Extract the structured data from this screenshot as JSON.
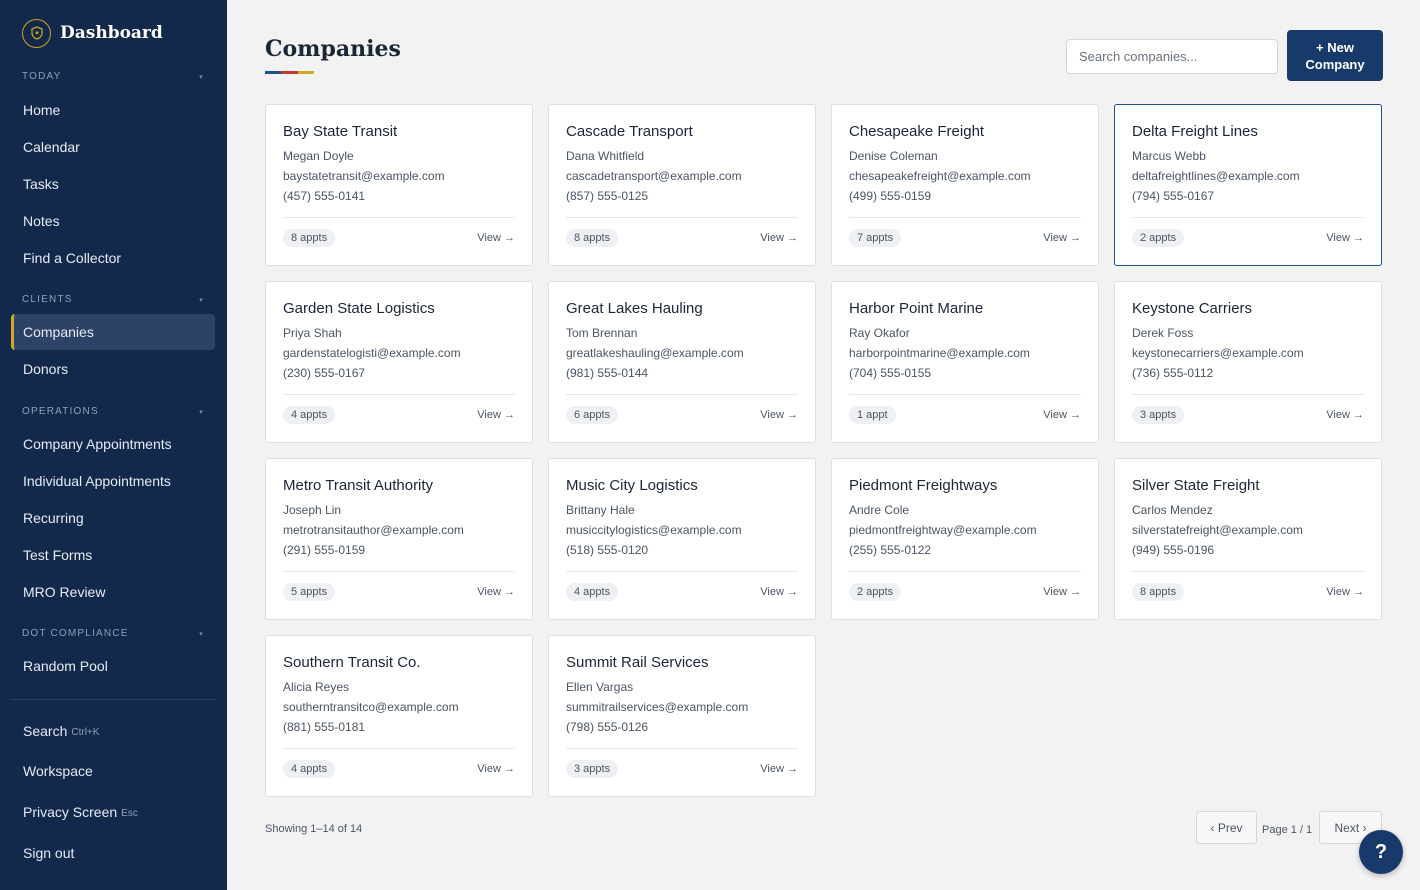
{
  "sidebar": {
    "brand": "Dashboard",
    "sections": [
      {
        "title": "TODAY",
        "items": [
          {
            "label": "Home"
          },
          {
            "label": "Calendar"
          },
          {
            "label": "Tasks"
          },
          {
            "label": "Notes"
          },
          {
            "label": "Find a Collector"
          }
        ]
      },
      {
        "title": "CLIENTS",
        "items": [
          {
            "label": "Companies",
            "active": true
          },
          {
            "label": "Donors"
          }
        ]
      },
      {
        "title": "OPERATIONS",
        "items": [
          {
            "label": "Company Appointments"
          },
          {
            "label": "Individual Appointments"
          },
          {
            "label": "Recurring"
          },
          {
            "label": "Test Forms"
          },
          {
            "label": "MRO Review"
          }
        ]
      },
      {
        "title": "DOT COMPLIANCE",
        "items": [
          {
            "label": "Random Pool"
          }
        ]
      }
    ],
    "bottom": {
      "search": {
        "label": "Search",
        "shortcut": "Ctrl+K"
      },
      "workspace": "Workspace",
      "privacy": {
        "label": "Privacy Screen",
        "shortcut": "Esc"
      },
      "signout": "Sign out"
    }
  },
  "header": {
    "title": "Companies",
    "search_placeholder": "Search companies...",
    "new_button": "+ New\nCompany"
  },
  "companies": [
    {
      "name": "Bay State Transit",
      "contact": "Megan Doyle",
      "email": "baystatetransit@example.com",
      "phone": "(457) 555-0141",
      "appts": "8 appts"
    },
    {
      "name": "Cascade Transport",
      "contact": "Dana Whitfield",
      "email": "cascadetransport@example.com",
      "phone": "(857) 555-0125",
      "appts": "8 appts"
    },
    {
      "name": "Chesapeake Freight",
      "contact": "Denise Coleman",
      "email": "chesapeakefreight@example.com",
      "phone": "(499) 555-0159",
      "appts": "7 appts"
    },
    {
      "name": "Delta Freight Lines",
      "contact": "Marcus Webb",
      "email": "deltafreightlines@example.com",
      "phone": "(794) 555-0167",
      "appts": "2 appts",
      "selected": true
    },
    {
      "name": "Garden State Logistics",
      "contact": "Priya Shah",
      "email": "gardenstatelogisti@example.com",
      "phone": "(230) 555-0167",
      "appts": "4 appts"
    },
    {
      "name": "Great Lakes Hauling",
      "contact": "Tom Brennan",
      "email": "greatlakeshauling@example.com",
      "phone": "(981) 555-0144",
      "appts": "6 appts"
    },
    {
      "name": "Harbor Point Marine",
      "contact": "Ray Okafor",
      "email": "harborpointmarine@example.com",
      "phone": "(704) 555-0155",
      "appts": "1 appt"
    },
    {
      "name": "Keystone Carriers",
      "contact": "Derek Foss",
      "email": "keystonecarriers@example.com",
      "phone": "(736) 555-0112",
      "appts": "3 appts"
    },
    {
      "name": "Metro Transit Authority",
      "contact": "Joseph Lin",
      "email": "metrotransitauthor@example.com",
      "phone": "(291) 555-0159",
      "appts": "5 appts"
    },
    {
      "name": "Music City Logistics",
      "contact": "Brittany Hale",
      "email": "musiccitylogistics@example.com",
      "phone": "(518) 555-0120",
      "appts": "4 appts"
    },
    {
      "name": "Piedmont Freightways",
      "contact": "Andre Cole",
      "email": "piedmontfreightway@example.com",
      "phone": "(255) 555-0122",
      "appts": "2 appts"
    },
    {
      "name": "Silver State Freight",
      "contact": "Carlos Mendez",
      "email": "silverstatefreight@example.com",
      "phone": "(949) 555-0196",
      "appts": "8 appts"
    },
    {
      "name": "Southern Transit Co.",
      "contact": "Alicia Reyes",
      "email": "southerntransitco@example.com",
      "phone": "(881) 555-0181",
      "appts": "4 appts"
    },
    {
      "name": "Summit Rail Services",
      "contact": "Ellen Vargas",
      "email": "summitrailservices@example.com",
      "phone": "(798) 555-0126",
      "appts": "3 appts"
    }
  ],
  "card_view_label": "View →",
  "footer": {
    "showing": "Showing 1–14 of 14",
    "prev": "‹ Prev",
    "page_info": "Page 1 / 1",
    "next": "Next ›",
    "help": "?"
  },
  "colors": {
    "sidebar_bg": "#13294b",
    "accent": "#173a6a",
    "active_marker": "#d4a72c",
    "title_underline": [
      "#1f4f8f",
      "#c0392b",
      "#d4a72c"
    ]
  }
}
